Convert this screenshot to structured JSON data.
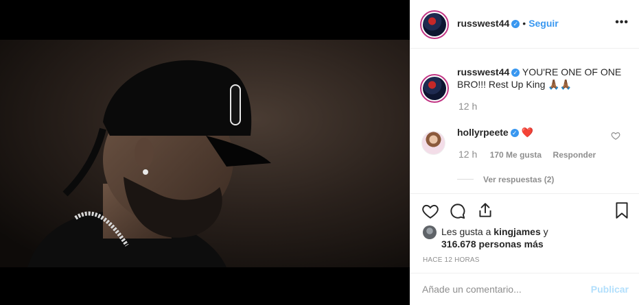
{
  "post": {
    "author": "russwest44",
    "follow_label": "Seguir",
    "separator": "•",
    "more_label": "•••"
  },
  "caption": {
    "author": "russwest44",
    "text": "YOU'RE ONE OF ONE BRO!!! Rest Up King 🙏🏾🙏🏾",
    "time": "12 h"
  },
  "comments": [
    {
      "author": "hollyrpeete",
      "text": "❤️",
      "time": "12 h",
      "likes": "170 Me gusta",
      "reply_label": "Responder",
      "view_replies": "Ver respuestas (2)"
    }
  ],
  "likes": {
    "prefix": "Les gusta a",
    "user": "kingjames",
    "connector": "y",
    "others": "316.678 personas más"
  },
  "timestamp": "HACE 12 HORAS",
  "add_comment": {
    "placeholder": "Añade un comentario...",
    "publish_label": "Publicar"
  },
  "icons": {
    "more": "more-horizontal-icon",
    "verified": "verified-badge-icon",
    "heart": "heart-icon",
    "comment": "comment-bubble-icon",
    "share": "share-icon",
    "save": "bookmark-icon"
  },
  "colors": {
    "link_blue": "#3897f0",
    "publish_disabled": "#b2dffc",
    "muted": "#8e8e8e",
    "heart_red": "#ed4956"
  }
}
